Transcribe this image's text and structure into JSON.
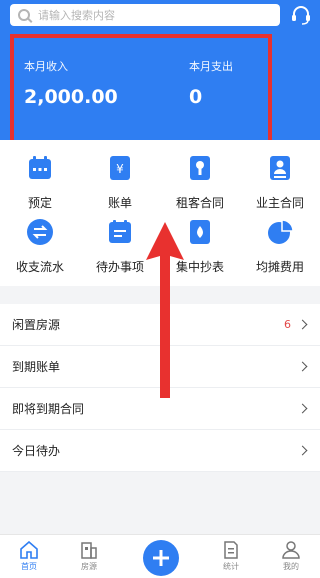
{
  "search": {
    "placeholder": "请输入搜索内容"
  },
  "stats": {
    "income_label": "本月收入",
    "income_value": "2,000.00",
    "expense_label": "本月支出",
    "expense_value": "0"
  },
  "shortcuts": [
    {
      "label": "预定",
      "icon": "calendar-icon"
    },
    {
      "label": "账单",
      "icon": "bill-icon"
    },
    {
      "label": "租客合同",
      "icon": "tenant-contract-icon"
    },
    {
      "label": "业主合同",
      "icon": "owner-contract-icon"
    },
    {
      "label": "收支流水",
      "icon": "transfer-icon"
    },
    {
      "label": "待办事项",
      "icon": "todo-icon"
    },
    {
      "label": "集中抄表",
      "icon": "meter-icon"
    },
    {
      "label": "均摊费用",
      "icon": "pie-chart-icon"
    }
  ],
  "list": [
    {
      "label": "闲置房源",
      "badge": "6"
    },
    {
      "label": "到期账单",
      "badge": ""
    },
    {
      "label": "即将到期合同",
      "badge": ""
    },
    {
      "label": "今日待办",
      "badge": ""
    }
  ],
  "tabs": [
    {
      "label": "首页",
      "icon": "home-icon",
      "active": true
    },
    {
      "label": "房源",
      "icon": "house-icon"
    },
    {
      "label": "统计",
      "icon": "document-icon"
    },
    {
      "label": "我的",
      "icon": "user-icon"
    }
  ],
  "colors": {
    "primary": "#2f7ef2",
    "highlight": "#e8312f",
    "badge": "#e24848"
  }
}
